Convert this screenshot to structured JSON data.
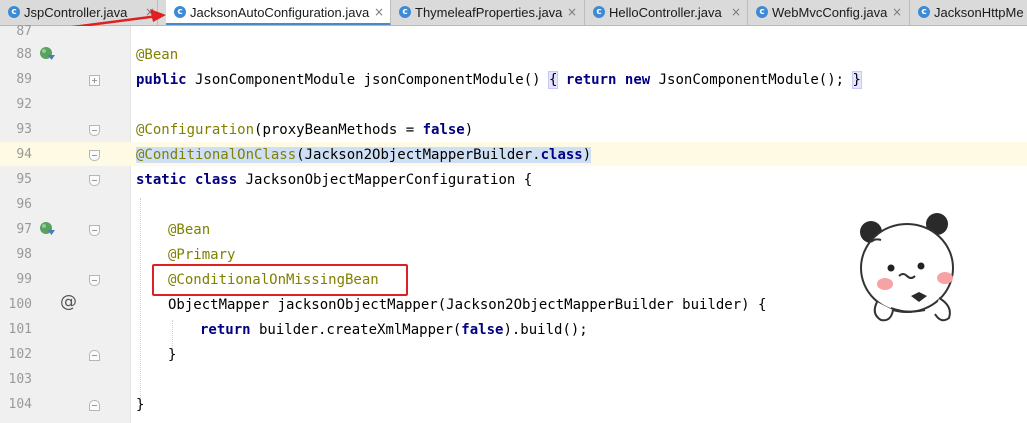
{
  "tabs": [
    {
      "label": "JspController.java",
      "active": false
    },
    {
      "label": "JacksonAutoConfiguration.java",
      "active": true
    },
    {
      "label": "ThymeleafProperties.java",
      "active": false
    },
    {
      "label": "HelloController.java",
      "active": false
    },
    {
      "label": "WebMvcConfig.java",
      "active": false
    },
    {
      "label": "JacksonHttpMe",
      "active": false
    }
  ],
  "tab_close_glyph": "×",
  "class_icon_letter": "c",
  "gutter": {
    "line_numbers": [
      "87",
      "88",
      "89",
      "92",
      "93",
      "94",
      "95",
      "96",
      "97",
      "98",
      "99",
      "100",
      "101",
      "102",
      "103",
      "104"
    ],
    "at_glyph": "@"
  },
  "code": {
    "l88": "@Bean",
    "l89_kw_public": "public",
    "l89_a": " JsonComponentModule jsonComponentModule",
    "l89_paren": "()",
    "l89_space": " ",
    "l89_brace_open": "{",
    "l89_kw_return": " return",
    "l89_kw_new": " new",
    "l89_b": " JsonComponentModule",
    "l89_c": "(); ",
    "l89_brace_close": "}",
    "l93_ann": "@Configuration",
    "l93_a": "(proxyBeanMethods = ",
    "l93_kw_false": "false",
    "l93_b": ")",
    "l94_ann": "@ConditionalOnClass",
    "l94_a": "(Jackson2ObjectMapperBuilder.",
    "l94_kw_class": "class",
    "l94_b": ")",
    "l95_kw_static": "static",
    "l95_kw_class": " class",
    "l95_a": " JacksonObjectMapperConfiguration {",
    "l97": "@Bean",
    "l98": "@Primary",
    "l99": "@ConditionalOnMissingBean",
    "l100": "ObjectMapper jacksonObjectMapper(Jackson2ObjectMapperBuilder builder) {",
    "l101_kw_return": "return",
    "l101_a": " builder.createXmlMapper(",
    "l101_kw_false": "false",
    "l101_b": ").build();",
    "l102": "}",
    "l104": "}"
  },
  "colors": {
    "annotation": "#808000",
    "keyword": "#000080",
    "highlight_box": "#e02020",
    "tab_active_underline": "#4a88c7",
    "arrow": "#e02020"
  },
  "icons": [
    "class-c-icon",
    "bean-run-icon",
    "override-at-icon",
    "fold-icon",
    "red-arrow",
    "panda-sticker"
  ]
}
